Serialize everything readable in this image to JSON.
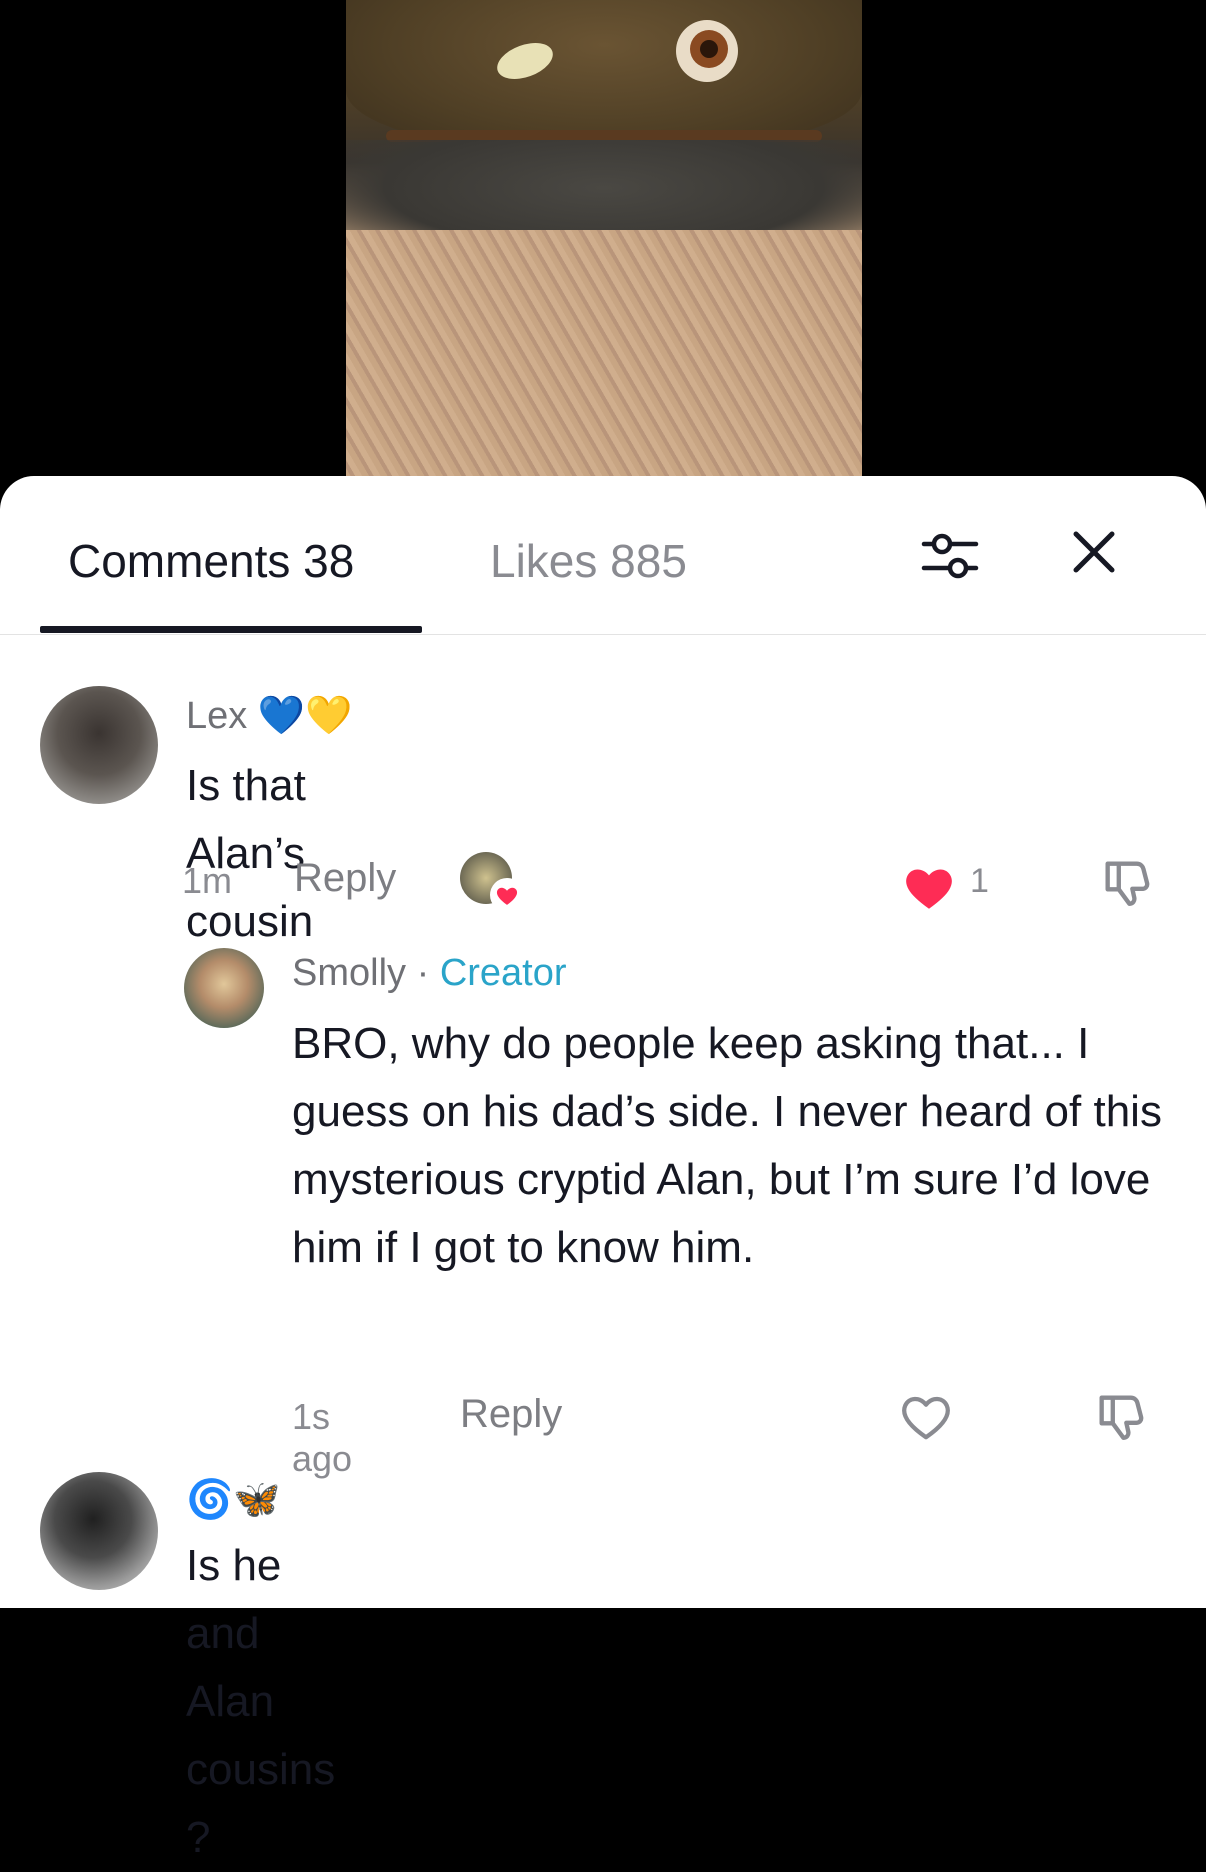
{
  "video": {
    "description_alt": ""
  },
  "tabs": {
    "comments_label": "Comments 38",
    "likes_label": "Likes 885"
  },
  "colors": {
    "primary_text": "#161823",
    "secondary_text": "#8a8b91",
    "creator_accent": "#2aa4c9",
    "like_red": "#fe2c55"
  },
  "comments": [
    {
      "username": "Lex",
      "emojis": "💙💛",
      "text": "Is that Alan’s cousin",
      "time": "1m",
      "reply_label": "Reply",
      "likes": "1",
      "liked": true,
      "creator_liked": true
    },
    {
      "username": "Smolly",
      "separator": " · ",
      "badge": "Creator",
      "text": "BRO, why do people keep asking that... I guess on his dad’s side. I never heard of this mysterious cryptid Alan, but I’m sure I’d love him if I got to know him.",
      "time": "1s ago",
      "reply_label": "Reply",
      "liked": false
    },
    {
      "username": "🌀🦋",
      "text": "Is he and Alan cousins ?"
    }
  ]
}
